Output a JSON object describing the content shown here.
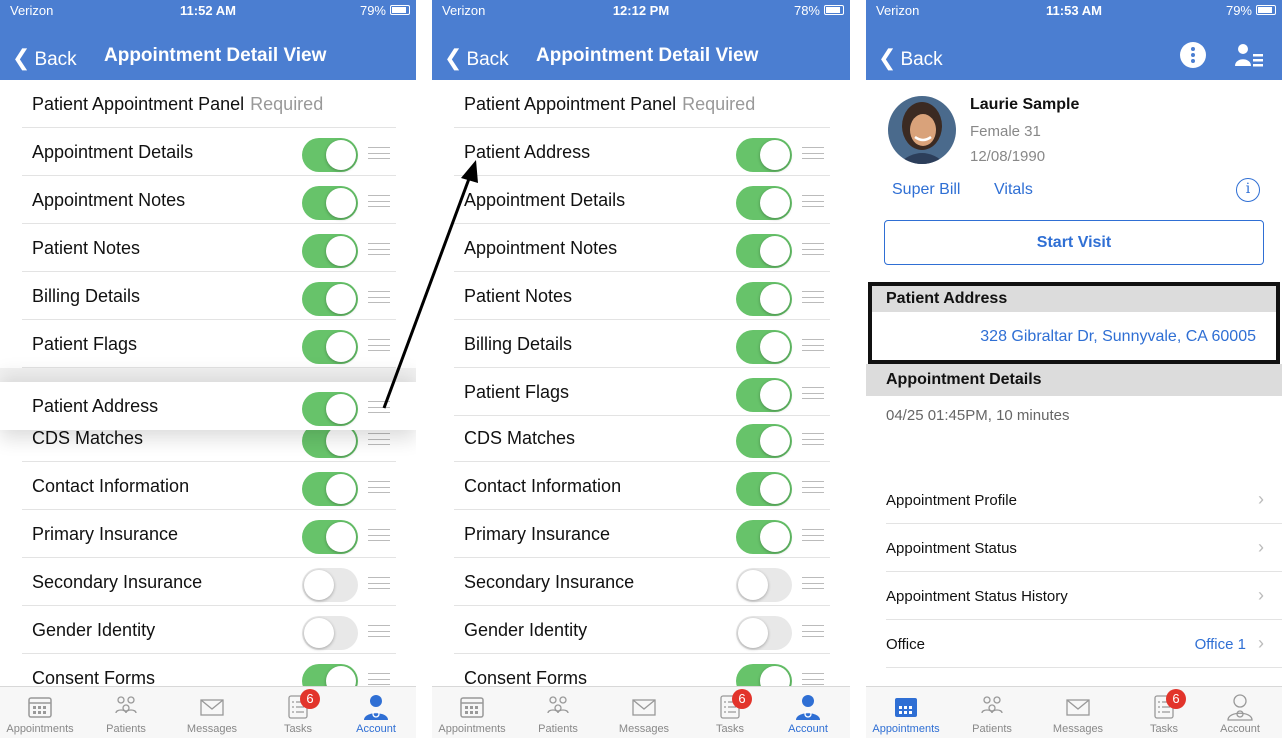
{
  "panel1": {
    "status": {
      "carrier": "Verizon",
      "time": "11:52 AM",
      "battery": "79%"
    },
    "nav": {
      "back": "Back",
      "title": "Appointment Detail View"
    },
    "header_row": {
      "label": "Patient Appointment Panel",
      "note": "Required"
    },
    "rows": [
      {
        "label": "Appointment Details",
        "on": true
      },
      {
        "label": "Appointment Notes",
        "on": true
      },
      {
        "label": "Patient Notes",
        "on": true
      },
      {
        "label": "Billing Details",
        "on": true
      },
      {
        "label": "Patient Flags",
        "on": true
      },
      {
        "label": "CDS Matches",
        "on": true
      },
      {
        "label": "Contact Information",
        "on": true
      },
      {
        "label": "Primary Insurance",
        "on": true
      },
      {
        "label": "Secondary Insurance",
        "on": false
      },
      {
        "label": "Gender Identity",
        "on": false
      },
      {
        "label": "Consent Forms",
        "on": true
      }
    ],
    "dragged": {
      "label": "Patient Address",
      "on": true
    }
  },
  "panel2": {
    "status": {
      "carrier": "Verizon",
      "time": "12:12 PM",
      "battery": "78%"
    },
    "nav": {
      "back": "Back",
      "title": "Appointment Detail View"
    },
    "header_row": {
      "label": "Patient Appointment Panel",
      "note": "Required"
    },
    "rows": [
      {
        "label": "Patient Address",
        "on": true
      },
      {
        "label": "Appointment Details",
        "on": true
      },
      {
        "label": "Appointment Notes",
        "on": true
      },
      {
        "label": "Patient Notes",
        "on": true
      },
      {
        "label": "Billing Details",
        "on": true
      },
      {
        "label": "Patient Flags",
        "on": true
      },
      {
        "label": "CDS Matches",
        "on": true
      },
      {
        "label": "Contact Information",
        "on": true
      },
      {
        "label": "Primary Insurance",
        "on": true
      },
      {
        "label": "Secondary Insurance",
        "on": false
      },
      {
        "label": "Gender Identity",
        "on": false
      },
      {
        "label": "Consent Forms",
        "on": true
      }
    ]
  },
  "panel3": {
    "status": {
      "carrier": "Verizon",
      "time": "11:53 AM",
      "battery": "79%"
    },
    "nav": {
      "back": "Back"
    },
    "patient": {
      "name": "Laurie Sample",
      "sex_age": "Female 31",
      "dob": "12/08/1990"
    },
    "links": {
      "superbill": "Super Bill",
      "vitals": "Vitals",
      "info": "i"
    },
    "start_visit": "Start Visit",
    "address_section": {
      "title": "Patient Address",
      "address": "328 Gibraltar Dr, Sunnyvale, CA 60005"
    },
    "appt_section": {
      "title": "Appointment Details",
      "time": "04/25 01:45PM, 10 minutes"
    },
    "profile_rows": [
      {
        "label": "Appointment Profile",
        "value": ""
      },
      {
        "label": "Appointment Status",
        "value": ""
      },
      {
        "label": "Appointment Status History",
        "value": ""
      },
      {
        "label": "Office",
        "value": "Office 1"
      }
    ]
  },
  "tabbar": {
    "tabs": [
      "Appointments",
      "Patients",
      "Messages",
      "Tasks",
      "Account"
    ],
    "badge": "6"
  },
  "colors": {
    "nav": "#4b7ed1",
    "toggle_on": "#67c36a",
    "link": "#2f6fd4",
    "badge": "#e2342b"
  }
}
